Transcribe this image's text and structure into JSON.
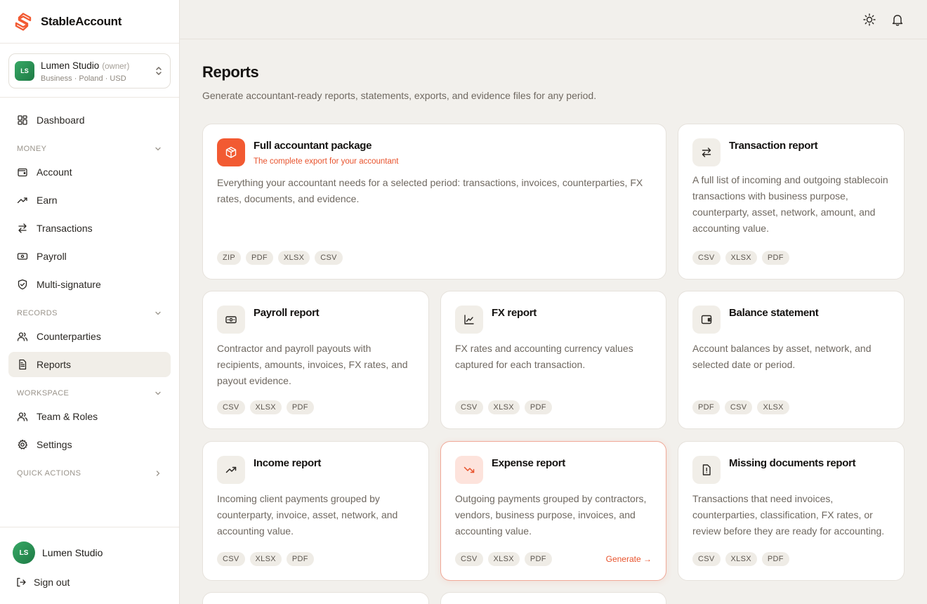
{
  "brand": {
    "name": "StableAccount"
  },
  "org": {
    "initials": "LS",
    "name": "Lumen Studio",
    "role": "(owner)",
    "meta": "Business · Poland · USD"
  },
  "nav": {
    "dashboard": "Dashboard",
    "money_section": "MONEY",
    "account": "Account",
    "earn": "Earn",
    "transactions": "Transactions",
    "payroll": "Payroll",
    "multisig": "Multi-signature",
    "records_section": "RECORDS",
    "counterparties": "Counterparties",
    "reports": "Reports",
    "workspace_section": "WORKSPACE",
    "team": "Team & Roles",
    "settings": "Settings",
    "quick_section": "QUICK ACTIONS"
  },
  "user": {
    "initials": "LS",
    "name": "Lumen Studio",
    "signout": "Sign out"
  },
  "page": {
    "title": "Reports",
    "subtitle": "Generate accountant-ready reports, statements, exports, and evidence files for any period."
  },
  "cards": [
    {
      "title": "Full accountant package",
      "tag": "The complete export for your accountant",
      "desc": "Everything your accountant needs for a selected period: transactions, invoices, counterparties, FX rates, documents, and evidence.",
      "formats": [
        "ZIP",
        "PDF",
        "XLSX",
        "CSV"
      ]
    },
    {
      "title": "Transaction report",
      "desc": "A full list of incoming and outgoing stablecoin transactions with business purpose, counterparty, asset, network, amount, and accounting value.",
      "formats": [
        "CSV",
        "XLSX",
        "PDF"
      ]
    },
    {
      "title": "Payroll report",
      "desc": "Contractor and payroll payouts with recipients, amounts, invoices, FX rates, and payout evidence.",
      "formats": [
        "CSV",
        "XLSX",
        "PDF"
      ]
    },
    {
      "title": "FX report",
      "desc": "FX rates and accounting currency values captured for each transaction.",
      "formats": [
        "CSV",
        "XLSX",
        "PDF"
      ]
    },
    {
      "title": "Balance statement",
      "desc": "Account balances by asset, network, and selected date or period.",
      "formats": [
        "PDF",
        "CSV",
        "XLSX"
      ]
    },
    {
      "title": "Income report",
      "desc": "Incoming client payments grouped by counterparty, invoice, asset, network, and accounting value.",
      "formats": [
        "CSV",
        "XLSX",
        "PDF"
      ]
    },
    {
      "title": "Expense report",
      "desc": "Outgoing payments grouped by contractors, vendors, business purpose, invoices, and accounting value.",
      "formats": [
        "CSV",
        "XLSX",
        "PDF"
      ],
      "action": "Generate →"
    },
    {
      "title": "Missing documents report",
      "desc": "Transactions that need invoices, counterparties, classification, FX rates, or review before they are ready for accounting.",
      "formats": [
        "CSV",
        "XLSX",
        "PDF"
      ]
    }
  ],
  "colors": {
    "accent": "#f25a32",
    "brand_green": "#2e9457",
    "background": "#f2f0ec"
  }
}
